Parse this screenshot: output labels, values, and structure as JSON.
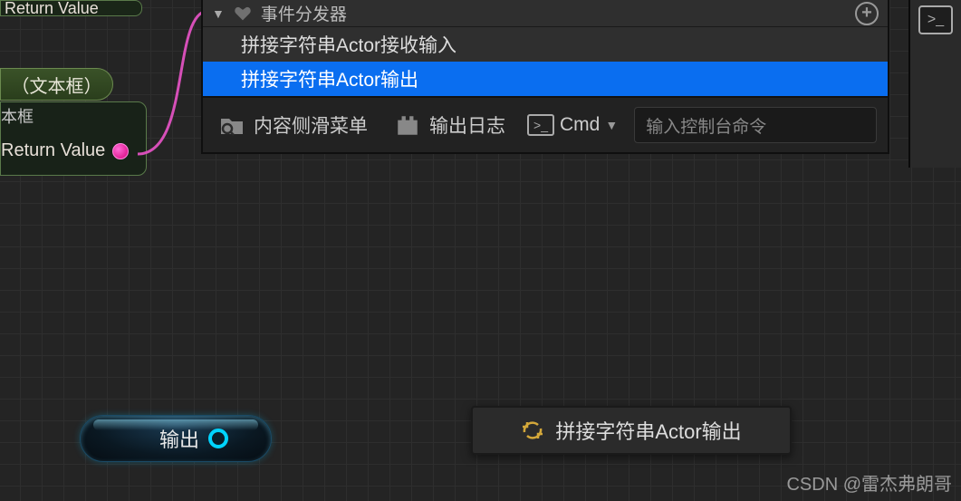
{
  "green_node": {
    "top_label": "Return Value",
    "mid_label": "（文本框）",
    "bot_trunc_label": "本框",
    "return_label": "Return Value"
  },
  "dispatcher": {
    "title": "事件分发器",
    "items": [
      {
        "label": "拼接字符串Actor接收输入",
        "selected": false
      },
      {
        "label": "拼接字符串Actor输出",
        "selected": true
      }
    ]
  },
  "toolbar": {
    "content_drawer": "内容侧滑菜单",
    "output_log": "输出日志",
    "cmd_label": "Cmd",
    "console_placeholder": "输入控制台命令"
  },
  "output_pill": {
    "label": "输出"
  },
  "tooltip": {
    "label": "拼接字符串Actor输出"
  },
  "watermark": "CSDN @雷杰弗朗哥"
}
